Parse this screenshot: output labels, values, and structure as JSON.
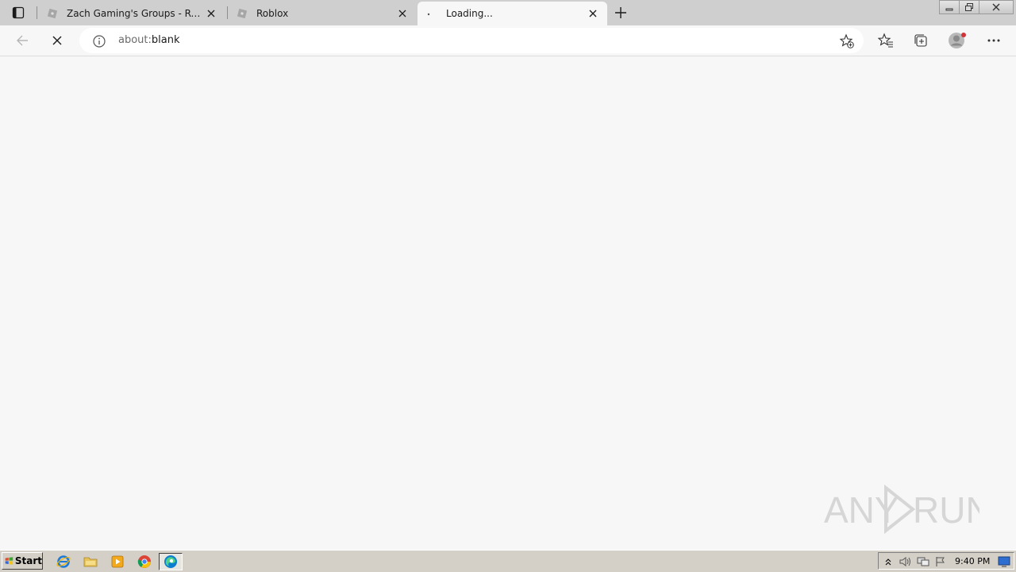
{
  "tabs": [
    {
      "title": "Zach Gaming's Groups - Roblox",
      "favicon": "roblox-icon",
      "active": false
    },
    {
      "title": "Roblox",
      "favicon": "roblox-icon",
      "active": false
    },
    {
      "title": "Loading...",
      "favicon": "loading-dot-icon",
      "active": true
    }
  ],
  "address_bar": {
    "scheme": "about:",
    "path": "blank"
  },
  "watermark": {
    "left": "ANY",
    "right": "RUN"
  },
  "taskbar": {
    "start_label": "Start",
    "apps": [
      "internet-explorer-icon",
      "file-explorer-icon",
      "media-player-icon",
      "chrome-icon",
      "edge-icon"
    ],
    "clock": "9:40 PM"
  },
  "colors": {
    "tabstrip": "#cfcfcf",
    "toolbar": "#f7f7f7",
    "taskbar": "#d4d0c8",
    "profile_badge": "#d13438"
  }
}
